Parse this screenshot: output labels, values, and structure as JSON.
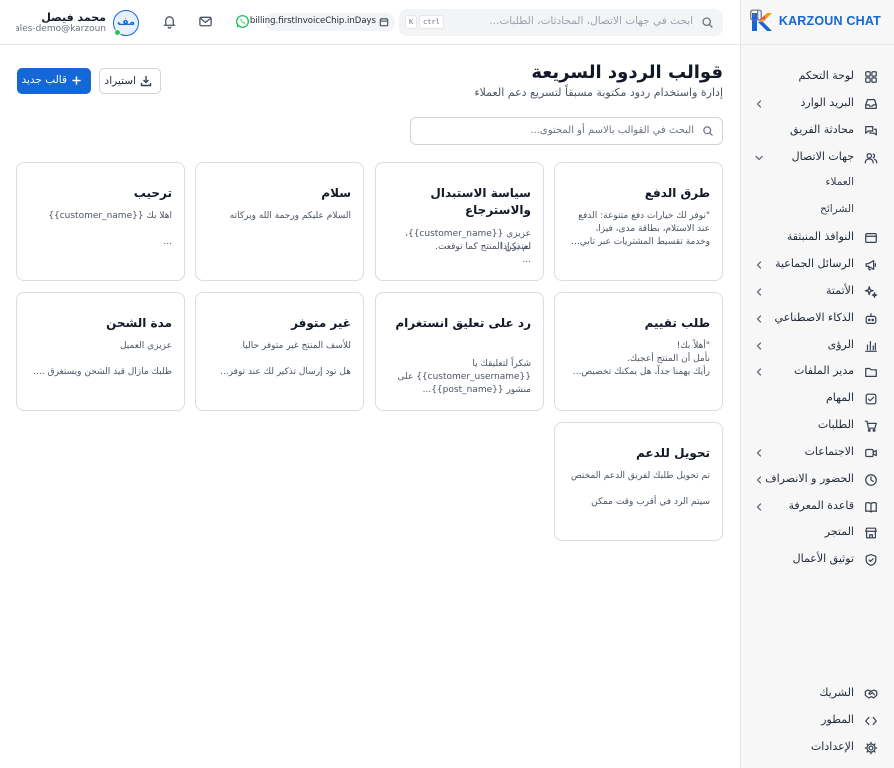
{
  "brand": {
    "name": "KARZOUN CHAT",
    "colors": {
      "blue": "#1467d6",
      "orange": "#f59e0b"
    }
  },
  "sidebar": {
    "items": [
      {
        "label": "لوحة التحكم",
        "icon": "dashboard-icon",
        "chevron": false
      },
      {
        "label": "البريد الوارد",
        "icon": "inbox-icon",
        "chevron": true
      },
      {
        "label": "محادثة الفريق",
        "icon": "team-chat-icon",
        "chevron": false
      },
      {
        "label": "جهات الاتصال",
        "icon": "contacts-icon",
        "chevron": true,
        "expanded": true
      },
      {
        "label": "العملاء",
        "sub": true
      },
      {
        "label": "الشرائح",
        "sub": true
      },
      {
        "label": "النوافذ المنبثقة",
        "icon": "popup-icon",
        "chevron": false
      },
      {
        "label": "الرسائل الجماعية",
        "icon": "megaphone-icon",
        "chevron": true
      },
      {
        "label": "الأتمتة",
        "icon": "sparkles-icon",
        "chevron": true
      },
      {
        "label": "الذكاء الاصطناعي",
        "icon": "bot-icon",
        "chevron": true
      },
      {
        "label": "الرؤى",
        "icon": "bar-chart-icon",
        "chevron": true
      },
      {
        "label": "مدير الملفات",
        "icon": "folder-icon",
        "chevron": true
      },
      {
        "label": "المهام",
        "icon": "task-check-icon",
        "chevron": false
      },
      {
        "label": "الطلبات",
        "icon": "cart-icon",
        "chevron": false
      },
      {
        "label": "الاجتماعات",
        "icon": "video-icon",
        "chevron": true
      },
      {
        "label": "الحضور و الانصراف",
        "icon": "clock-icon",
        "chevron": true
      },
      {
        "label": "قاعدة المعرفة",
        "icon": "book-icon",
        "chevron": true
      },
      {
        "label": "المتجر",
        "icon": "store-icon",
        "chevron": false
      },
      {
        "label": "توثيق الأعمال",
        "icon": "shield-check-icon",
        "chevron": false
      }
    ],
    "bottom": [
      {
        "label": "الشريك",
        "icon": "handshake-icon"
      },
      {
        "label": "المطور",
        "icon": "code-icon"
      },
      {
        "label": "الإعدادات",
        "icon": "gear-icon"
      }
    ]
  },
  "topbar": {
    "search_placeholder": "ابحث في جهات الاتصال، المحادثات، الطلبات...",
    "kbd_ctrl": "ctrl",
    "kbd_k": "K",
    "billing_chip": "billing.firstInvoiceChip.inDays",
    "user": {
      "initials": "مف",
      "name": "محمد فيصل",
      "email": "sales-demo@karzoun..."
    }
  },
  "page": {
    "title": "قوالب الردود السريعة",
    "subtitle": "إدارة واستخدام ردود مكتوبة مسبقاً لتسريع دعم العملاء",
    "new_button": "قالب جديد",
    "import_button": "استيراد",
    "search_placeholder": "البحث في القوالب بالاسم أو المحتوى..."
  },
  "templates": [
    {
      "title": "طرق الدفع",
      "lines": [
        "\"نوفر لك خيارات دفع متنوعة: الدفع",
        "عند الاستلام، بطاقة مدى، فيزا،",
        "وخدمة تقسيط المشتريات عبر تابي..."
      ]
    },
    {
      "title": "سياسة الاستبدال والاسترجاع",
      "lines": [
        "عزيزي {{customer_name}}، نعتذر إذا",
        "لم يكن المنتج كما توقعت.",
        "..."
      ]
    },
    {
      "title": "سلام",
      "lines": [
        "السلام عليكم ورحمة الله وبركاته"
      ]
    },
    {
      "title": "ترحيب",
      "lines": [
        "اهلا بك {{customer_name}}",
        "",
        "..."
      ]
    },
    {
      "title": "طلب تقييم",
      "lines": [
        "\"أهلاً بك!",
        "نأمل أن المنتج أعجبك.",
        "رأيك يهمنا جداً، هل يمكنك تخصيص..."
      ]
    },
    {
      "title": "رد على تعليق انستغرام",
      "lines": [
        "شكراً لتعليقك يا",
        "{{customer_username}} على",
        "منشور {{post_name}}..."
      ]
    },
    {
      "title": "غير متوفر",
      "lines": [
        "للأسف المنتج غير متوفر حاليا",
        "",
        "هل تود إرسال تذكير لك عند توفر..."
      ]
    },
    {
      "title": "مدة الشحن",
      "lines": [
        "عزيزي العميل",
        "",
        "طلبك مازال قيد الشحن ويستغرق ...."
      ]
    },
    {
      "title": "تحويل للدعم",
      "lines": [
        "تم تحويل طلبك لفريق الدعم المختص",
        "",
        "سيتم الرد في أقرب وقت ممكن"
      ]
    }
  ]
}
